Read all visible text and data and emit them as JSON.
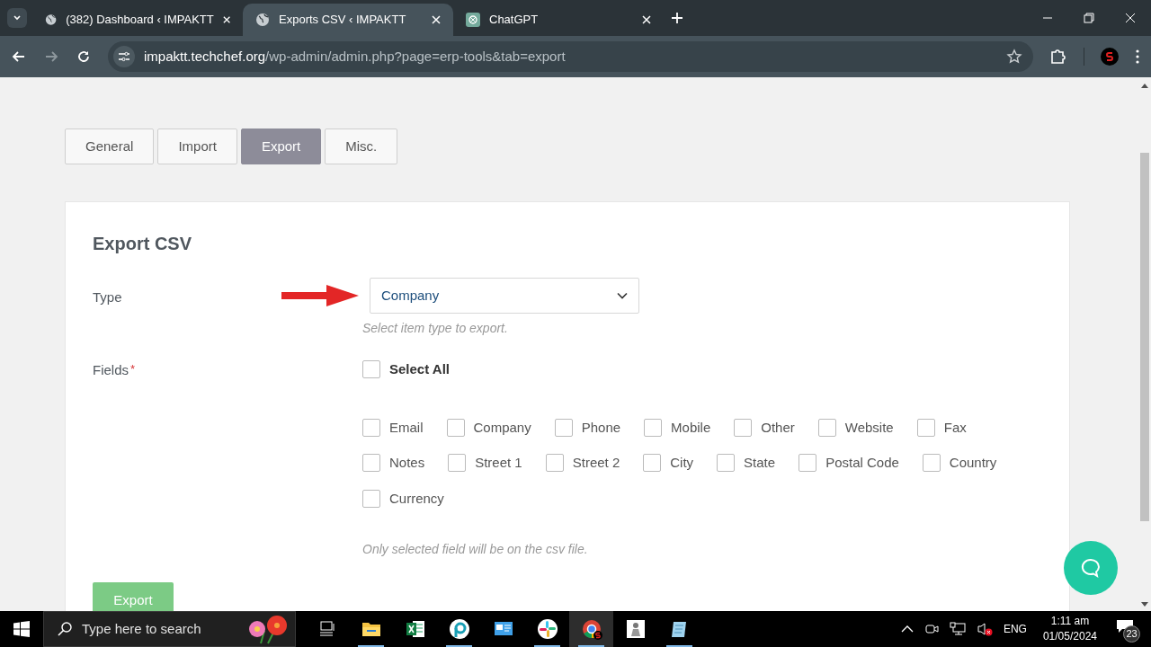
{
  "browser": {
    "tabs": [
      {
        "title": "(382) Dashboard ‹ IMPAKTT",
        "selected": false,
        "kind": "globe"
      },
      {
        "title": "Exports CSV ‹ IMPAKTT",
        "selected": true,
        "kind": "globe"
      },
      {
        "title": "ChatGPT",
        "selected": false,
        "kind": "chat"
      }
    ],
    "url": {
      "host": "impaktt.techchef.org",
      "path": "/wp-admin/admin.php?page=erp-tools&tab=export"
    }
  },
  "page_tabs": [
    {
      "label": "General",
      "selected": false
    },
    {
      "label": "Import",
      "selected": false
    },
    {
      "label": "Export",
      "selected": true
    },
    {
      "label": "Misc.",
      "selected": false
    }
  ],
  "panel": {
    "title": "Export CSV",
    "type": {
      "label": "Type",
      "value": "Company",
      "help": "Select item type to export."
    },
    "fields": {
      "label": "Fields",
      "required": "*",
      "select_all": {
        "label": "Select All",
        "checked": false
      },
      "options": [
        {
          "label": "Email",
          "checked": false
        },
        {
          "label": "Company",
          "checked": false
        },
        {
          "label": "Phone",
          "checked": false
        },
        {
          "label": "Mobile",
          "checked": false
        },
        {
          "label": "Other",
          "checked": false
        },
        {
          "label": "Website",
          "checked": false
        },
        {
          "label": "Fax",
          "checked": false
        },
        {
          "label": "Notes",
          "checked": false
        },
        {
          "label": "Street 1",
          "checked": false
        },
        {
          "label": "Street 2",
          "checked": false
        },
        {
          "label": "City",
          "checked": false
        },
        {
          "label": "State",
          "checked": false
        },
        {
          "label": "Postal Code",
          "checked": false
        },
        {
          "label": "Country",
          "checked": false
        },
        {
          "label": "Currency",
          "checked": false
        }
      ],
      "help": "Only selected field will be on the csv file."
    },
    "button": "Export"
  },
  "taskbar": {
    "search_placeholder": "Type here to search",
    "apps": [
      {
        "kind": "taskview",
        "running": false,
        "selected": false
      },
      {
        "kind": "folder",
        "running": true,
        "selected": false
      },
      {
        "kind": "sheet",
        "running": false,
        "selected": false
      },
      {
        "kind": "ring",
        "running": true,
        "selected": false
      },
      {
        "kind": "panel",
        "running": false,
        "selected": false
      },
      {
        "kind": "pinwheel",
        "running": true,
        "selected": false
      },
      {
        "kind": "browser",
        "running": true,
        "selected": true
      },
      {
        "kind": "figure",
        "running": false,
        "selected": false
      },
      {
        "kind": "notepad",
        "running": true,
        "selected": false
      }
    ],
    "language": "ENG",
    "time": "1:11 am",
    "date": "01/05/2024",
    "notifications": "23"
  }
}
